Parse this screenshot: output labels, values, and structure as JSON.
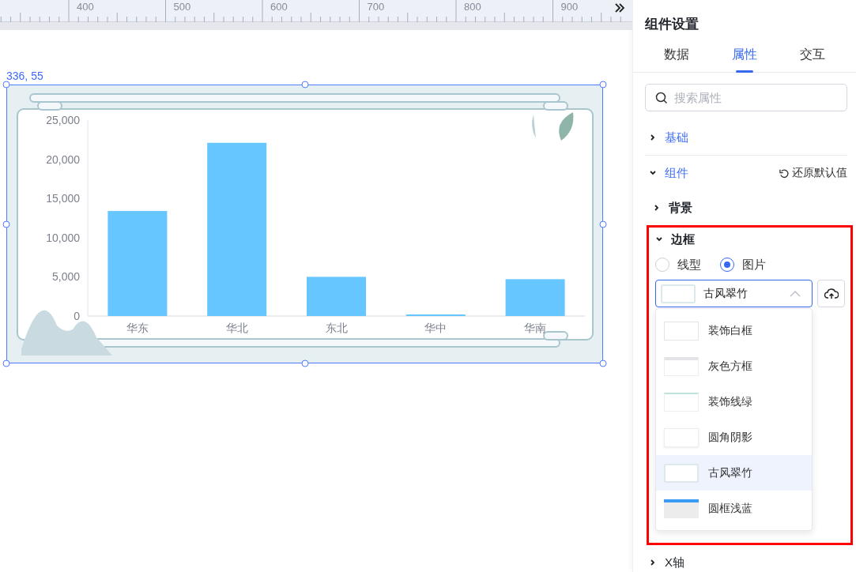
{
  "ruler": {
    "labels": [
      "400",
      "500",
      "600",
      "700",
      "800",
      "900"
    ]
  },
  "canvas": {
    "position_label": "336, 55",
    "chart_data": {
      "type": "bar",
      "categories": [
        "华东",
        "华北",
        "东北",
        "华中",
        "华南"
      ],
      "series": [
        {
          "color": "#66c6ff",
          "values": [
            13400,
            22100,
            5000,
            200,
            4700
          ]
        }
      ],
      "ylim": [
        0,
        25000
      ],
      "yticks": [
        {
          "value": 0,
          "label": "0"
        },
        {
          "value": 5000,
          "label": "5,000"
        },
        {
          "value": 10000,
          "label": "10,000"
        },
        {
          "value": 15000,
          "label": "15,000"
        },
        {
          "value": 20000,
          "label": "20,000"
        },
        {
          "value": 25000,
          "label": "25,000"
        }
      ]
    }
  },
  "panel": {
    "title": "组件设置",
    "tabs": [
      {
        "label": "数据",
        "selected": false
      },
      {
        "label": "属性",
        "selected": true
      },
      {
        "label": "交互",
        "selected": false
      }
    ],
    "search": {
      "placeholder": "搜索属性"
    },
    "sections": [
      {
        "label": "基础",
        "kind": "group",
        "expanded": false
      },
      {
        "label": "组件",
        "kind": "group",
        "expanded": true,
        "reset_label": "还原默认值",
        "children": [
          {
            "label": "背景",
            "expanded": false
          },
          {
            "label": "边框",
            "expanded": true,
            "highlighted": true,
            "radios": [
              {
                "label": "线型",
                "selected": false
              },
              {
                "label": "图片",
                "selected": true
              }
            ],
            "select": {
              "value": "古风翠竹",
              "kind": "ancient",
              "open": true,
              "options": [
                {
                  "label": "装饰白框",
                  "kind": "white-corner",
                  "selected": false
                },
                {
                  "label": "灰色方框",
                  "kind": "grey-top",
                  "selected": false
                },
                {
                  "label": "装饰线绿",
                  "kind": "green-line",
                  "selected": false
                },
                {
                  "label": "圆角阴影",
                  "kind": "shadow",
                  "selected": false
                },
                {
                  "label": "古风翠竹",
                  "kind": "ancient",
                  "selected": true
                },
                {
                  "label": "圆框浅蓝",
                  "kind": "blue-top",
                  "selected": false
                }
              ]
            }
          }
        ]
      },
      {
        "label": "X轴",
        "kind": "item",
        "expanded": false
      }
    ]
  }
}
